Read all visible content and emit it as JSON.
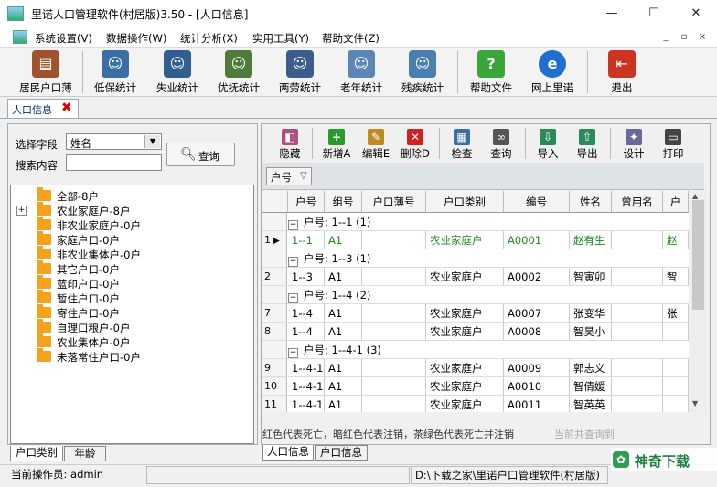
{
  "window": {
    "title": "里诺人口管理软件(村居版)3.50 - [人口信息]",
    "minimize": "—",
    "maximize": "☐",
    "close": "✕"
  },
  "menu": {
    "items": [
      "系统设置(V)",
      "数据操作(W)",
      "统计分析(X)",
      "实用工具(Y)",
      "帮助文件(Z)"
    ],
    "mdi_minimize": "_",
    "mdi_restore": "▫",
    "mdi_close": "×"
  },
  "toolbar": {
    "buttons": [
      {
        "label": "居民户口薄",
        "icon": "household-book-icon",
        "color": "#a0522d"
      },
      {
        "label": "低保统计",
        "icon": "person-icon",
        "color": "#3a6ea5"
      },
      {
        "label": "失业统计",
        "icon": "person-icon",
        "color": "#2f5f8f"
      },
      {
        "label": "优抚统计",
        "icon": "soldier-icon",
        "color": "#4e7a3a"
      },
      {
        "label": "两劳统计",
        "icon": "police-icon",
        "color": "#3b5c8c"
      },
      {
        "label": "老年统计",
        "icon": "elder-icon",
        "color": "#5b86b5"
      },
      {
        "label": "残疾统计",
        "icon": "disabled-icon",
        "color": "#4a7fb0"
      },
      {
        "label": "帮助文件",
        "icon": "help-icon",
        "color": "#3aa63a"
      },
      {
        "label": "网上里诺",
        "icon": "ie-icon",
        "color": "#1e6fd0"
      },
      {
        "label": "退出",
        "icon": "exit-icon",
        "color": "#cc3322"
      }
    ]
  },
  "doc_tab": {
    "label": "人口信息",
    "close": "✖"
  },
  "left": {
    "field_label": "选择字段",
    "field_value": "姓名",
    "search_label": "搜索内容",
    "search_value": "",
    "query_button": "查询",
    "tree": [
      {
        "label": "全部-8户",
        "expandable": false
      },
      {
        "label": "农业家庭户-8户",
        "expandable": true
      },
      {
        "label": "非农业家庭户-0户",
        "expandable": false
      },
      {
        "label": "家庭户口-0户",
        "expandable": false
      },
      {
        "label": "非农业集体户-0户",
        "expandable": false
      },
      {
        "label": "其它户口-0户",
        "expandable": false
      },
      {
        "label": "蓝印户口-0户",
        "expandable": false
      },
      {
        "label": "暂住户口-0户",
        "expandable": false
      },
      {
        "label": "寄住户口-0户",
        "expandable": false
      },
      {
        "label": "自理口粮户-0户",
        "expandable": false
      },
      {
        "label": "农业集体户-0户",
        "expandable": false
      },
      {
        "label": "未落常住户口-0户",
        "expandable": false
      }
    ],
    "bottom_tabs": [
      "户口类别",
      "年龄"
    ]
  },
  "right": {
    "buttons": [
      {
        "label": "隐藏",
        "icon": "hide-icon",
        "color": "#b05080"
      },
      {
        "label": "新增A",
        "icon": "add-icon",
        "color": "#2a9a2a"
      },
      {
        "label": "编辑E",
        "icon": "edit-icon",
        "color": "#c08a20"
      },
      {
        "label": "删除D",
        "icon": "delete-icon",
        "color": "#d02020"
      },
      {
        "label": "检查",
        "icon": "check-icon",
        "color": "#3a6ea5"
      },
      {
        "label": "查询",
        "icon": "binoculars-icon",
        "color": "#555555"
      },
      {
        "label": "导入",
        "icon": "import-icon",
        "color": "#2a8a5a"
      },
      {
        "label": "导出",
        "icon": "export-icon",
        "color": "#2a8a5a"
      },
      {
        "label": "设计",
        "icon": "design-icon",
        "color": "#6a6a9a"
      },
      {
        "label": "打印",
        "icon": "print-icon",
        "color": "#444444"
      }
    ],
    "group_chip": "户号",
    "group_chip_arrow": "▽",
    "columns": [
      "户号",
      "组号",
      "户口薄号",
      "户口类别",
      "编号",
      "姓名",
      "曾用名",
      "户"
    ],
    "rows": [
      {
        "type": "group",
        "label": "户号: 1--1 (1)"
      },
      {
        "type": "data",
        "num": "1",
        "current": true,
        "green": true,
        "cells": [
          "1--1",
          "A1",
          "",
          "农业家庭户",
          "A0001",
          "赵有生",
          "",
          "赵"
        ]
      },
      {
        "type": "group",
        "label": "户号: 1--3 (1)"
      },
      {
        "type": "data",
        "num": "2",
        "cells": [
          "1--3",
          "A1",
          "",
          "农业家庭户",
          "A0002",
          "智寅卯",
          "",
          "智"
        ]
      },
      {
        "type": "group",
        "label": "户号: 1--4 (2)"
      },
      {
        "type": "data",
        "num": "7",
        "cells": [
          "1--4",
          "A1",
          "",
          "农业家庭户",
          "A0007",
          "张变华",
          "",
          "张"
        ]
      },
      {
        "type": "data",
        "num": "8",
        "cells": [
          "1--4",
          "A1",
          "",
          "农业家庭户",
          "A0008",
          "智昊小",
          "",
          ""
        ]
      },
      {
        "type": "group",
        "label": "户号: 1--4-1 (3)"
      },
      {
        "type": "data",
        "num": "9",
        "cells": [
          "1--4-1",
          "A1",
          "",
          "农业家庭户",
          "A0009",
          "郭志义",
          "",
          ""
        ]
      },
      {
        "type": "data",
        "num": "10",
        "cells": [
          "1--4-1",
          "A1",
          "",
          "农业家庭户",
          "A0010",
          "智倩媛",
          "",
          ""
        ]
      },
      {
        "type": "data",
        "num": "11",
        "cells": [
          "1--4-1",
          "A1",
          "",
          "农业家庭户",
          "A0011",
          "智英英",
          "",
          ""
        ]
      }
    ],
    "legend": "红色代表死亡，暗红色代表注销，茶绿色代表死亡并注销",
    "count_label": "当前共查询到",
    "bottom_tabs": [
      "人口信息",
      "户口信息"
    ]
  },
  "status": {
    "operator": "当前操作员: admin",
    "path": "D:\\下载之家\\里诺户口管理软件(村居版)"
  },
  "brand": {
    "text": "神奇下载"
  }
}
